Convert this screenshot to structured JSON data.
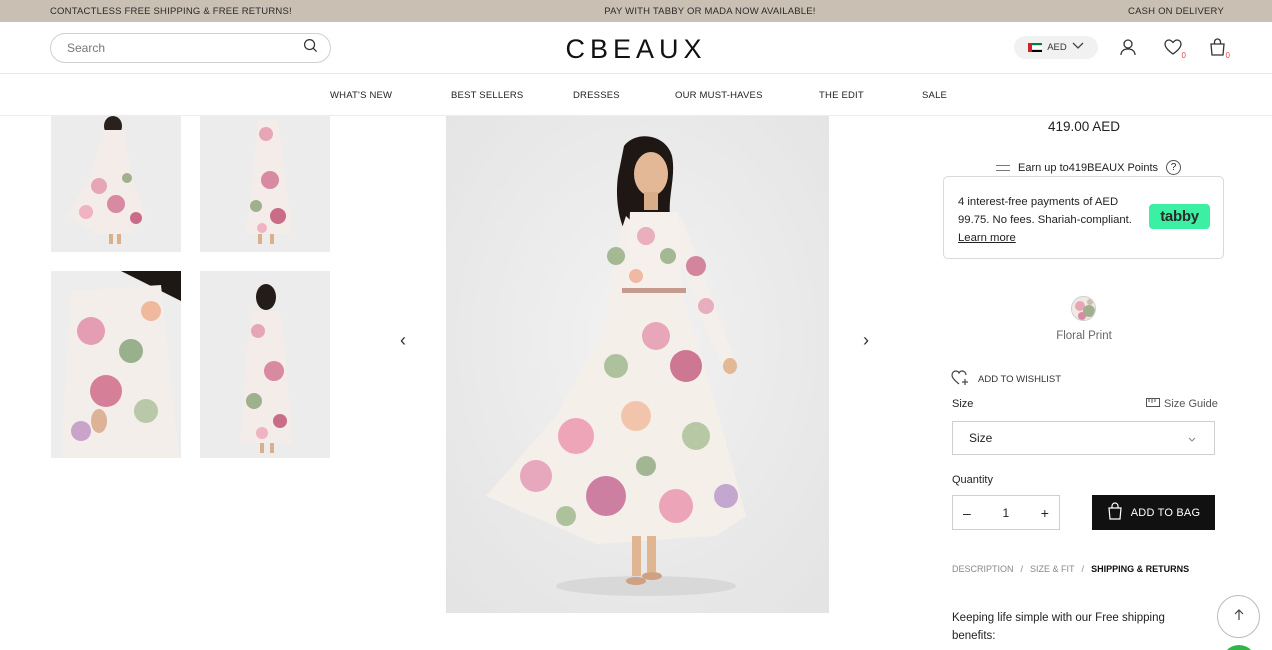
{
  "announcement": {
    "left": "CONTACTLESS FREE SHIPPING & FREE RETURNS!",
    "center": "PAY WITH TABBY OR MADA NOW AVAILABLE!",
    "right": "CASH ON DELIVERY"
  },
  "header": {
    "search_placeholder": "Search",
    "logo": "CBEAUX",
    "currency": "AED",
    "wishlist_count": "0",
    "bag_count": "0"
  },
  "nav": {
    "items": [
      "WHAT'S NEW",
      "BEST SELLERS",
      "DRESSES",
      "OUR MUST-HAVES",
      "THE EDIT",
      "SALE"
    ]
  },
  "product": {
    "price": "419.00 AED",
    "points_text": "Earn up to419BEAUX Points",
    "tabby": {
      "text": "4 interest-free payments of AED 99.75. No fees. Shariah-compliant.",
      "learn_more": "Learn more",
      "logo": "tabby"
    },
    "color_label": "Floral Print",
    "wishlist_label": "ADD TO WISHLIST",
    "size_label": "Size",
    "size_guide": "Size Guide",
    "size_select": "Size",
    "quantity_label": "Quantity",
    "quantity_value": "1",
    "minus": "–",
    "plus": "+",
    "add_to_bag": "ADD TO BAG",
    "tabs": [
      "DESCRIPTION",
      "SIZE & FIT",
      "SHIPPING & RETURNS"
    ],
    "tab_separator": "/",
    "shipping_text": "Keeping life simple with our Free shipping benefits:"
  },
  "gallery": {
    "prev": "‹",
    "next": "›"
  },
  "colors": {
    "announce_bg": "#c9bfb3",
    "tabby_green": "#3bf0a2",
    "button_black": "#111111",
    "badge_red": "#e0474c"
  }
}
